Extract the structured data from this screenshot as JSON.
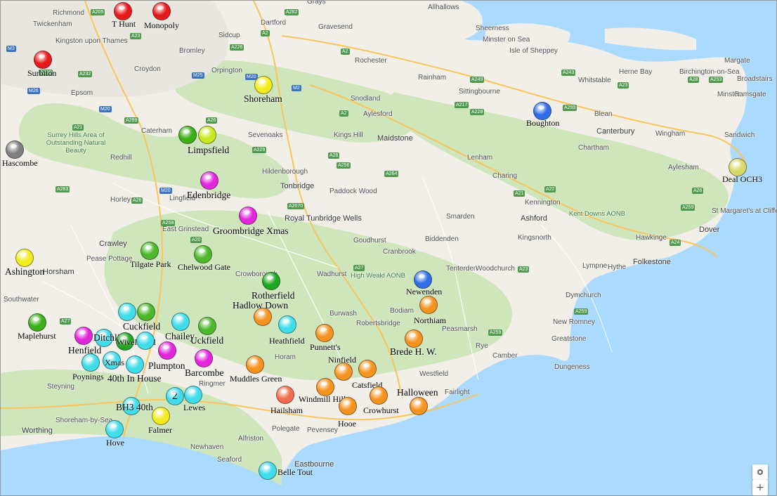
{
  "map_labels": {
    "towns": [
      {
        "name": "Grays",
        "big": false
      },
      {
        "name": "Allhallows",
        "big": false
      },
      {
        "name": "Richmond",
        "big": false
      },
      {
        "name": "Twickenham",
        "big": false
      },
      {
        "name": "Kingston upon Thames",
        "big": false
      },
      {
        "name": "Dartford",
        "big": false
      },
      {
        "name": "Gravesend",
        "big": false
      },
      {
        "name": "Sheerness",
        "big": false
      },
      {
        "name": "Minster on Sea",
        "big": false
      },
      {
        "name": "Isle of Sheppey",
        "big": false
      },
      {
        "name": "Margate",
        "big": false
      },
      {
        "name": "Broadstairs",
        "big": false
      },
      {
        "name": "Ramsgate",
        "big": false
      },
      {
        "name": "Bromley",
        "big": false
      },
      {
        "name": "Sidcup",
        "big": false
      },
      {
        "name": "Croydon",
        "big": false
      },
      {
        "name": "Orpington",
        "big": false
      },
      {
        "name": "Rochester",
        "big": false
      },
      {
        "name": "Rainham",
        "big": false
      },
      {
        "name": "Sittingbourne",
        "big": false
      },
      {
        "name": "Whitstable",
        "big": false
      },
      {
        "name": "Herne Bay",
        "big": false
      },
      {
        "name": "Birchington-on-Sea",
        "big": false
      },
      {
        "name": "Minster",
        "big": false
      },
      {
        "name": "Epsom",
        "big": false
      },
      {
        "name": "Snodland",
        "big": false
      },
      {
        "name": "Aylesford",
        "big": false
      },
      {
        "name": "Blean",
        "big": false
      },
      {
        "name": "Canterbury",
        "big": true
      },
      {
        "name": "Wingham",
        "big": false
      },
      {
        "name": "Sandwich",
        "big": false
      },
      {
        "name": "Caterham",
        "big": false
      },
      {
        "name": "Sevenoaks",
        "big": false
      },
      {
        "name": "Kings Hill",
        "big": false
      },
      {
        "name": "Maidstone",
        "big": true
      },
      {
        "name": "Chartham",
        "big": false
      },
      {
        "name": "Redhill",
        "big": false
      },
      {
        "name": "Hildenborough",
        "big": false
      },
      {
        "name": "Lenham",
        "big": false
      },
      {
        "name": "Charing",
        "big": false
      },
      {
        "name": "Aylesham",
        "big": false
      },
      {
        "name": "Tonbridge",
        "big": true
      },
      {
        "name": "Paddock Wood",
        "big": false
      },
      {
        "name": "Horley",
        "big": false
      },
      {
        "name": "Lingfield",
        "big": false
      },
      {
        "name": "Kennington",
        "big": false
      },
      {
        "name": "Royal Tunbridge Wells",
        "big": true
      },
      {
        "name": "Smarden",
        "big": false
      },
      {
        "name": "Ashford",
        "big": true
      },
      {
        "name": "St Margaret's at Cliffe",
        "big": false
      },
      {
        "name": "Dover",
        "big": true
      },
      {
        "name": "East Grinstead",
        "big": false
      },
      {
        "name": "Goudhurst",
        "big": false
      },
      {
        "name": "Biddenden",
        "big": false
      },
      {
        "name": "Kingsnorth",
        "big": false
      },
      {
        "name": "Crawley",
        "big": true
      },
      {
        "name": "Cranbrook",
        "big": false
      },
      {
        "name": "Hawkinge",
        "big": false
      },
      {
        "name": "Pease Pottage",
        "big": false
      },
      {
        "name": "Tenterden",
        "big": false
      },
      {
        "name": "Woodchurch",
        "big": false
      },
      {
        "name": "Folkestone",
        "big": true
      },
      {
        "name": "Horsham",
        "big": true
      },
      {
        "name": "Crowborough",
        "big": false
      },
      {
        "name": "Wadhurst",
        "big": false
      },
      {
        "name": "Lympne",
        "big": false
      },
      {
        "name": "Hythe",
        "big": false
      },
      {
        "name": "Southwater",
        "big": false
      },
      {
        "name": "Dymchurch",
        "big": false
      },
      {
        "name": "Burwash",
        "big": false
      },
      {
        "name": "Bodiam",
        "big": false
      },
      {
        "name": "Robertsbridge",
        "big": false
      },
      {
        "name": "Peasmarsh",
        "big": false
      },
      {
        "name": "New Romney",
        "big": false
      },
      {
        "name": "Rye",
        "big": false
      },
      {
        "name": "Greatstone",
        "big": false
      },
      {
        "name": "Camber",
        "big": false
      },
      {
        "name": "Horam",
        "big": false
      },
      {
        "name": "Westfield",
        "big": false
      },
      {
        "name": "Dungeness",
        "big": false
      },
      {
        "name": "Ringmer",
        "big": false
      },
      {
        "name": "Steyning",
        "big": false
      },
      {
        "name": "Fairlight",
        "big": false
      },
      {
        "name": "Worthing",
        "big": true
      },
      {
        "name": "Shoreham-by-Sea",
        "big": false
      },
      {
        "name": "Polegate",
        "big": false
      },
      {
        "name": "Pevensey",
        "big": false
      },
      {
        "name": "Alfriston",
        "big": false
      },
      {
        "name": "Newhaven",
        "big": false
      },
      {
        "name": "Seaford",
        "big": false
      },
      {
        "name": "Eastbourne",
        "big": true
      }
    ],
    "green_areas": [
      "Surrey Hills Area of Outstanding Natural Beauty",
      "High Weald AONB",
      "Kent Downs AONB"
    ],
    "roads": [
      "A205",
      "A282",
      "M3",
      "A23",
      "A2",
      "A226",
      "A2",
      "A249",
      "A299",
      "A28",
      "A253",
      "A240",
      "A232",
      "M25",
      "M20",
      "M2",
      "A2",
      "A217",
      "A243",
      "A23",
      "M26",
      "M20",
      "A299",
      "A21",
      "A26",
      "A228",
      "A229",
      "A28",
      "A256",
      "A264",
      "A22",
      "A26",
      "M20",
      "A258",
      "A20",
      "A2070",
      "A21",
      "A259",
      "A24",
      "A23",
      "A27",
      "A259",
      "A283",
      "A26",
      "A27",
      "A259"
    ]
  },
  "venues": [
    {
      "label": "T Hunt",
      "color": "#e8191b",
      "large": false
    },
    {
      "label": "Monopoly",
      "color": "#e8191b",
      "large": false
    },
    {
      "label": "Surbiton",
      "color": "#e8191b",
      "large": false
    },
    {
      "label": "Shoreham",
      "color": "#f2ec1e",
      "large": true
    },
    {
      "label": "Boughton",
      "color": "#2f6ee6",
      "large": false
    },
    {
      "label": "Hascombe",
      "color": "#7f7f7f",
      "large": false
    },
    {
      "label": "Limpsfield",
      "color": "#3daf17",
      "large": true
    },
    {
      "label": "",
      "color": "#c8e81f",
      "large": false
    },
    {
      "label": "Edenbridge",
      "color": "#e326dc",
      "large": true
    },
    {
      "label": "Deal OCH3",
      "color": "#d9d96b",
      "large": false
    },
    {
      "label": "Groombridge Xmas",
      "color": "#e326dc",
      "large": true
    },
    {
      "label": "Ashington",
      "color": "#f2ec1e",
      "large": true
    },
    {
      "label": "Tilgate Park",
      "color": "#4db82a",
      "large": false
    },
    {
      "label": "Chelwood Gate",
      "color": "#4db82a",
      "large": false
    },
    {
      "label": "Rotherfield",
      "color": "#1fa51f",
      "large": true
    },
    {
      "label": "Newenden",
      "color": "#2f6ee6",
      "large": false
    },
    {
      "label": "Hadlow Down",
      "color": "#f6931f",
      "large": true
    },
    {
      "label": "Northiam",
      "color": "#f6931f",
      "large": false
    },
    {
      "label": "Maplehurst",
      "color": "#3daf17",
      "large": false
    },
    {
      "label": "Cuckfield",
      "color": "#3fdcea",
      "large": true
    },
    {
      "label": "",
      "color": "#4db82a",
      "large": false
    },
    {
      "label": "Chailey",
      "color": "#3fdcea",
      "large": true
    },
    {
      "label": "Uckfield",
      "color": "#4db82a",
      "large": true
    },
    {
      "label": "Heathfield",
      "color": "#3fdcea",
      "large": false
    },
    {
      "label": "Punnett's",
      "color": "#f6931f",
      "large": false
    },
    {
      "label": "Brede H. W.",
      "color": "#f6931f",
      "large": true
    },
    {
      "label": "Henfield",
      "color": "#e326dc",
      "large": true
    },
    {
      "label": "Ditchling",
      "color": "#3fdcea",
      "large": true
    },
    {
      "label": "Wivelsfield",
      "color": "#1fa51f",
      "large": false
    },
    {
      "label": "",
      "color": "#3fdcea",
      "large": false
    },
    {
      "label": "Plumpton",
      "color": "#e326dc",
      "large": true
    },
    {
      "label": "Barcombe",
      "color": "#e326dc",
      "large": true
    },
    {
      "label": "Poynings",
      "color": "#3fdcea",
      "large": false
    },
    {
      "label": "Xmas",
      "color": "#3fdcea",
      "large": false
    },
    {
      "label": "40th In House",
      "color": "#3fdcea",
      "large": true
    },
    {
      "label": "Muddles Green",
      "color": "#f6931f",
      "large": false
    },
    {
      "label": "Ninfield",
      "color": "#f6931f",
      "large": false
    },
    {
      "label": "Catsfield",
      "color": "#f6931f",
      "large": false
    },
    {
      "label": "Windmill Hill",
      "color": "#f6931f",
      "large": false
    },
    {
      "label": "Crowhurst",
      "color": "#f6931f",
      "large": false
    },
    {
      "label": "Halloween",
      "color": "#f6931f",
      "large": true
    },
    {
      "label": "Hailsham",
      "color": "#f26d4d",
      "large": false
    },
    {
      "label": "Hooe",
      "color": "#f6931f",
      "large": false
    },
    {
      "label": "BH3 40th",
      "color": "#3fdcea",
      "large": true
    },
    {
      "label": "Lewes",
      "color": "#3fdcea",
      "large": false
    },
    {
      "label": "",
      "color": "#3fdcea",
      "large": false,
      "count": "2"
    },
    {
      "label": "Falmer",
      "color": "#f2ec1e",
      "large": false
    },
    {
      "label": "Hove",
      "color": "#3fdcea",
      "large": false
    },
    {
      "label": "Belle Tout",
      "color": "#3fdcea",
      "large": false
    }
  ],
  "controls": {
    "locate_icon": "target-icon",
    "zoom_in": "+"
  }
}
